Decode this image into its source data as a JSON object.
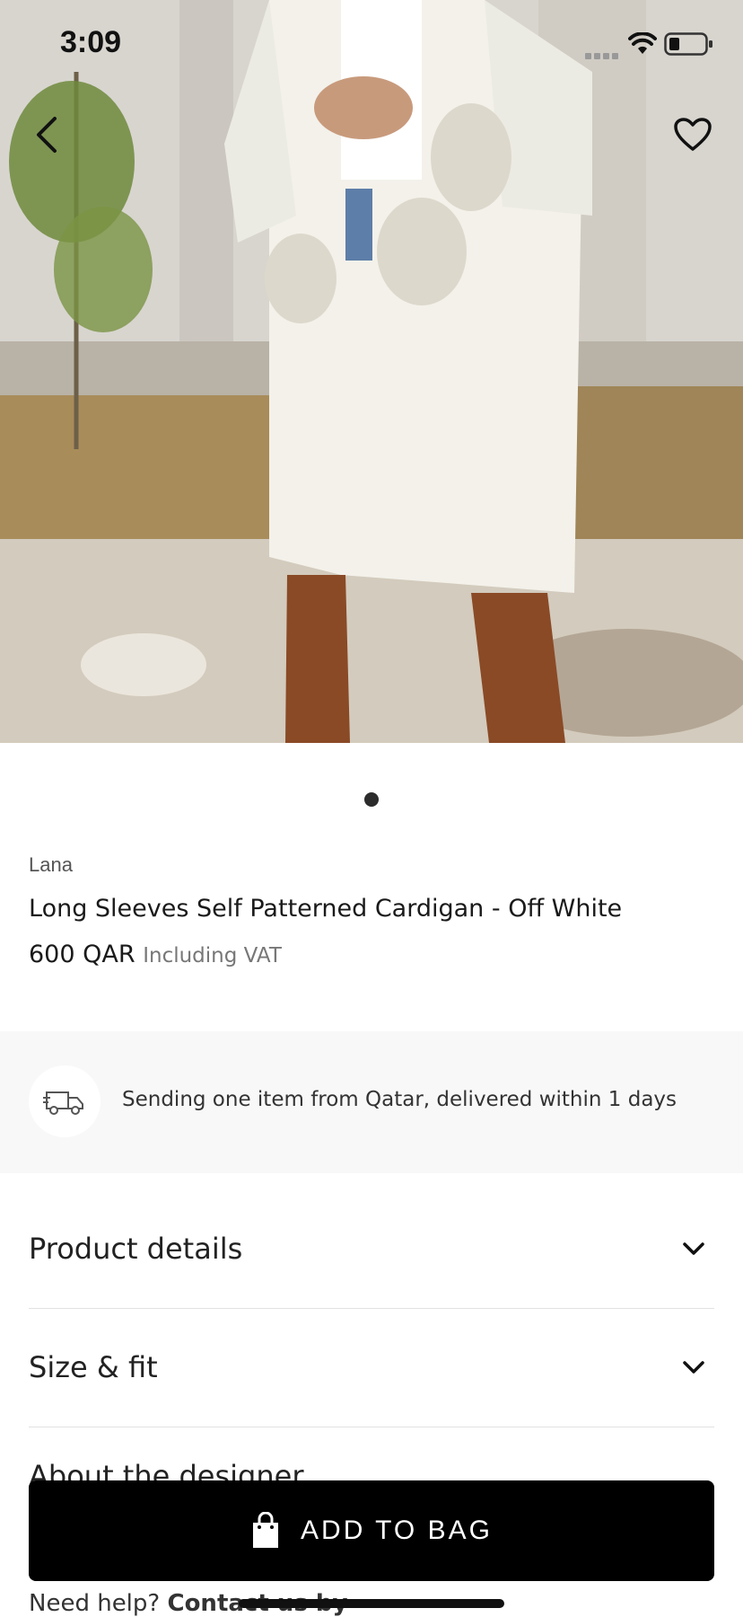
{
  "status_bar": {
    "time": "3:09"
  },
  "product": {
    "brand": "Lana",
    "title": "Long Sleeves Self Patterned Cardigan - Off White",
    "price": "600 QAR",
    "vat_note": "Including VAT",
    "image_count": 1,
    "active_image": 1
  },
  "delivery": {
    "icon": "truck-icon",
    "text": "Sending one item from Qatar, delivered within 1 days"
  },
  "accordion": [
    {
      "label": "Product details",
      "icon": "chevron-down-icon"
    },
    {
      "label": "Size & fit",
      "icon": "chevron-down-icon"
    },
    {
      "label": "About the designer",
      "icon": "chevron-down-icon"
    }
  ],
  "cta": {
    "label": "ADD TO BAG",
    "icon": "shopping-bag-icon"
  },
  "help": {
    "prefix": "Need help?",
    "link": "Contact us by"
  },
  "icons": {
    "back": "back-arrow-icon",
    "favorite": "heart-icon"
  },
  "colors": {
    "cta_background": "#000000",
    "cta_text": "#ffffff",
    "delivery_background": "#f8f8f8"
  }
}
